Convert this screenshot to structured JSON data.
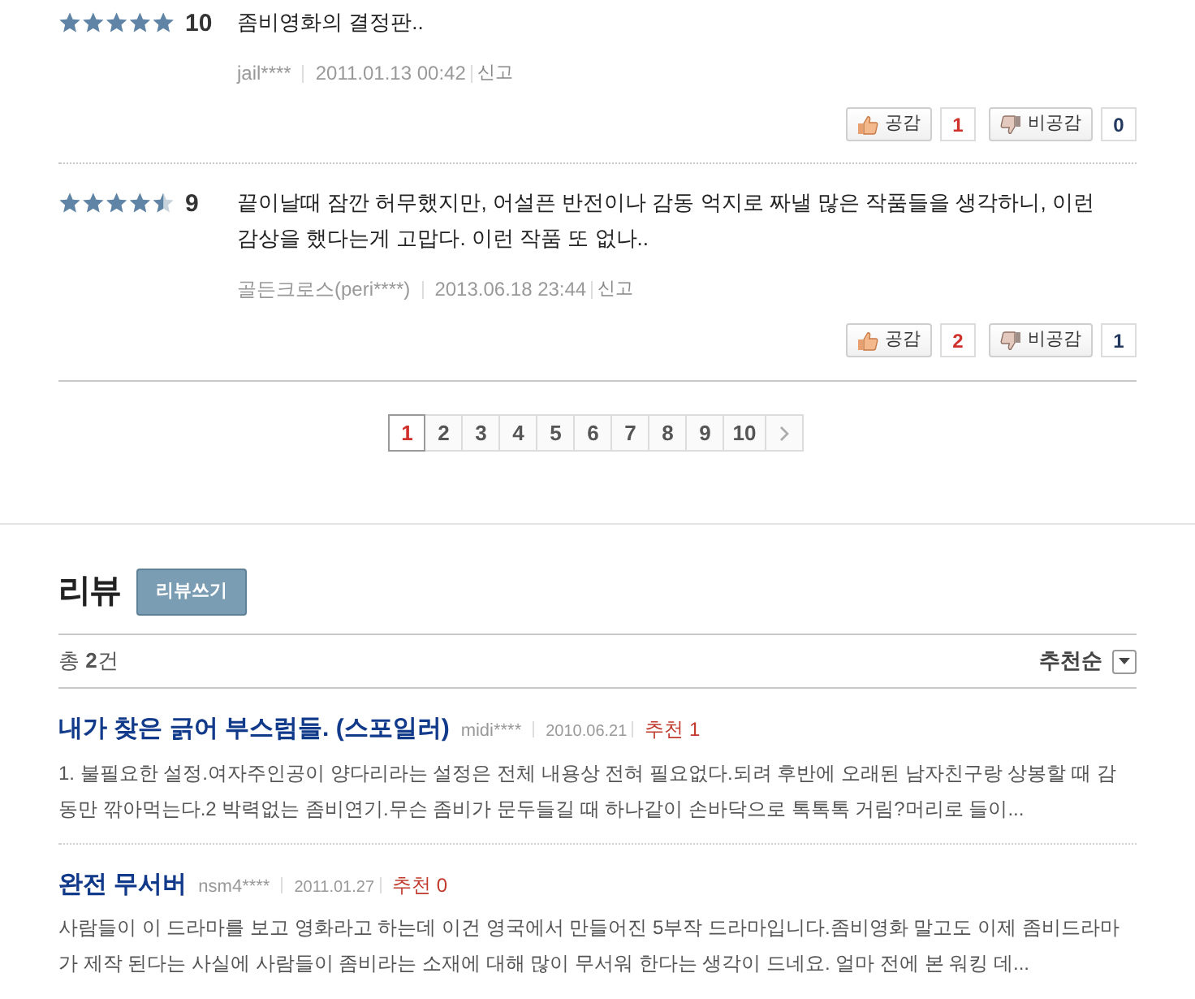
{
  "comments": [
    {
      "stars": 5,
      "score": "10",
      "text": "좀비영화의 결정판..",
      "author": "jail****",
      "date": "2011.01.13 00:42",
      "report": "신고",
      "like": {
        "label": "공감",
        "count": "1"
      },
      "dislike": {
        "label": "비공감",
        "count": "0"
      }
    },
    {
      "stars": 4.5,
      "score": "9",
      "text": "끝이날때 잠깐 허무했지만, 어설픈 반전이나 감동 억지로 짜낼 많은 작품들을 생각하니, 이런 감상을 했다는게 고맙다. 이런 작품 또 없나..",
      "author": "골든크로스(peri****)",
      "date": "2013.06.18 23:44",
      "report": "신고",
      "like": {
        "label": "공감",
        "count": "2"
      },
      "dislike": {
        "label": "비공감",
        "count": "1"
      }
    }
  ],
  "pagination": {
    "pages": [
      {
        "label": "1",
        "selected": true
      },
      {
        "label": "2",
        "selected": false
      },
      {
        "label": "3",
        "selected": false
      },
      {
        "label": "4",
        "selected": false
      },
      {
        "label": "5",
        "selected": false
      },
      {
        "label": "6",
        "selected": false
      },
      {
        "label": "7",
        "selected": false
      },
      {
        "label": "8",
        "selected": false
      },
      {
        "label": "9",
        "selected": false
      },
      {
        "label": "10",
        "selected": false
      }
    ]
  },
  "review_section": {
    "title": "리뷰",
    "write_button": "리뷰쓰기",
    "total": "총 **2**건",
    "sort": "추천순",
    "reviews": [
      {
        "title": "내가 찾은 긁어 부스럼들. (스포일러)",
        "author": "midi****",
        "date": "2010.06.21",
        "recommend": "추천 1",
        "summary": "1. 불필요한 설정.여자주인공이 양다리라는 설정은 전체 내용상 전혀 필요없다.되려 후반에 오래된 남자친구랑 상봉할 때 감동만 깎아먹는다.2 박력없는 좀비연기.무슨 좀비가 문두들길 때 하나같이 손바닥으로 톡톡톡 거림?머리로 들이..."
      },
      {
        "title": "완전 무서버",
        "author": "nsm4****",
        "date": "2011.01.27",
        "recommend": "추천 0",
        "summary": "사람들이 이 드라마를 보고 영화라고 하는데 이건 영국에서 만들어진 5부작 드라마입니다.좀비영화 말고도 이제 좀비드라마가 제작 된다는 사실에 사람들이 좀비라는 소재에 대해 많이 무서워 한다는 생각이 드네요. 얼마 전에 본 워킹 데..."
      }
    ]
  }
}
